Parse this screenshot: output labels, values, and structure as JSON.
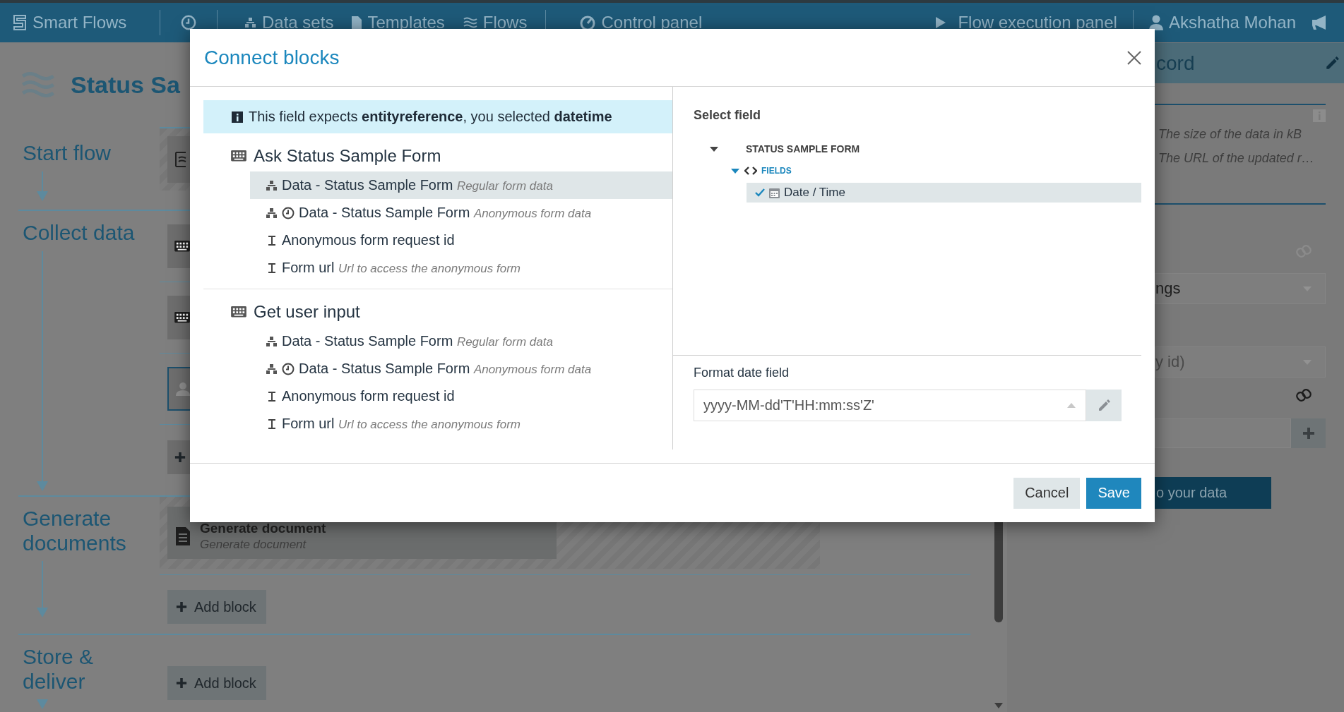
{
  "top_bar": {
    "app_name": "Smart Flows",
    "nav": [
      "Data sets",
      "Templates",
      "Flows",
      "Control panel"
    ],
    "execution_panel": "Flow execution panel",
    "user_name": "Akshatha Mohan"
  },
  "page": {
    "title": "Status Sa",
    "sections": [
      {
        "label": "Start flow"
      },
      {
        "label": "Collect data"
      },
      {
        "label": "Generate documents"
      },
      {
        "label": "Store & deliver"
      }
    ],
    "collect_blocks": [
      {
        "kind": "form",
        "selected": false
      },
      {
        "kind": "form",
        "selected": false
      },
      {
        "kind": "user",
        "selected": true
      }
    ],
    "generate_block": {
      "title": "Generate document",
      "subtitle": "Generate document"
    },
    "add_buttons": [
      "Add block",
      "Add block"
    ]
  },
  "side_panel": {
    "title": "cord",
    "hints": [
      "The size of the data in kB",
      "The URL of the updated r…"
    ],
    "select_value": "ngs",
    "select_placeholder": "y id)",
    "action_button": "o your data"
  },
  "dialog": {
    "title": "Connect blocks",
    "notice": "This field expects **entityreference**, you selected **datetime**",
    "sources": [
      {
        "name": "Ask Status Sample Form",
        "outputs": [
          {
            "kind": "data",
            "label": "Data - Status Sample Form",
            "hint": "Regular form data",
            "selected": true
          },
          {
            "kind": "anonymous_data",
            "label": "Data - Status Sample Form",
            "hint": "Anonymous form data",
            "selected": false
          },
          {
            "kind": "text",
            "label": "Anonymous form request id",
            "selected": false
          },
          {
            "kind": "text",
            "label": "Form url",
            "hint": "Url to access the anonymous form",
            "selected": false
          }
        ]
      },
      {
        "name": "Get user input",
        "outputs": [
          {
            "kind": "data",
            "label": "Data - Status Sample Form",
            "hint": "Regular form data",
            "selected": false
          },
          {
            "kind": "anonymous_data",
            "label": "Data - Status Sample Form",
            "hint": "Anonymous form data",
            "selected": false
          },
          {
            "kind": "text",
            "label": "Anonymous form request id",
            "selected": false
          },
          {
            "kind": "text",
            "label": "Form url",
            "hint": "Url to access the anonymous form",
            "selected": false
          }
        ]
      }
    ],
    "select_field": {
      "heading": "Select field",
      "tree": [
        {
          "label": "STATUS SAMPLE FORM",
          "expanded": true,
          "children": [
            {
              "label": "FIELDS",
              "expanded": true,
              "children": [
                {
                  "label": "Date / Time",
                  "selected": true
                }
              ]
            }
          ]
        }
      ]
    },
    "format": {
      "label": "Format date field",
      "value": "yyyy-MM-dd'T'HH:mm:ss'Z'"
    },
    "buttons": [
      {
        "label": "Cancel",
        "kind": "secondary"
      },
      {
        "label": "Save",
        "kind": "primary"
      }
    ]
  }
}
